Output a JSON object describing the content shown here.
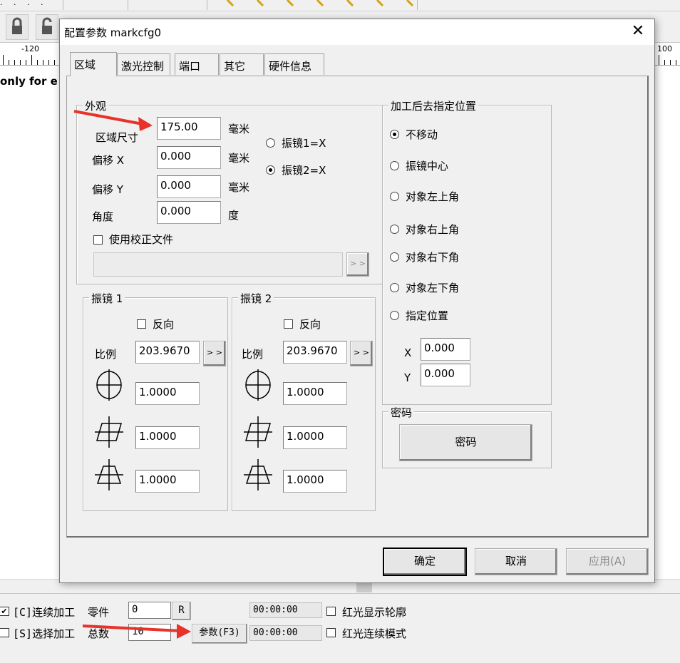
{
  "app": {
    "canvas_text": "only for e",
    "ruler": {
      "left_label": "-120",
      "right_label": "100"
    },
    "bottom": {
      "continuous_label": "[C]连续加工",
      "continuous_checked": true,
      "select_label": "[S]选择加工",
      "select_checked": false,
      "part_label": "零件",
      "part_value": "0",
      "total_label": "总数",
      "total_value": "10",
      "r_button": "R",
      "params_button": "参数(F3)",
      "time1": "00:00:00",
      "time2": "00:00:00",
      "redlight_outline_label": "红光显示轮廓",
      "redlight_continuous_label": "红光连续模式"
    }
  },
  "dialog": {
    "title": "配置参数 markcfg0",
    "close_glyph": "✕",
    "tabs": [
      "区域",
      "激光控制",
      "端口",
      "其它",
      "硬件信息"
    ],
    "active_tab": 0,
    "appearance": {
      "group_label": "外观",
      "area_size_label": "区域尺寸",
      "area_size_value": "175.00",
      "area_size_unit": "毫米",
      "offset_x_label": "偏移 X",
      "offset_x_value": "0.000",
      "offset_x_unit": "毫米",
      "offset_y_label": "偏移 Y",
      "offset_y_value": "0.000",
      "offset_y_unit": "毫米",
      "angle_label": "角度",
      "angle_value": "0.000",
      "angle_unit": "度",
      "galvo1_x_label": "振镜1=X",
      "galvo2_x_label": "振镜2=X",
      "galvo_selected": 2,
      "use_correction_label": "使用校正文件",
      "correction_file_value": "",
      "browse_label": "> >"
    },
    "galvo1": {
      "group_label": "振镜 1",
      "reverse_label": "反向",
      "scale_label": "比例",
      "scale_value": "203.9670",
      "scale_btn": "> >",
      "v1": "1.0000",
      "v2": "1.0000",
      "v3": "1.0000"
    },
    "galvo2": {
      "group_label": "振镜 2",
      "reverse_label": "反向",
      "scale_label": "比例",
      "scale_value": "203.9670",
      "scale_btn": "> >",
      "v1": "1.0000",
      "v2": "1.0000",
      "v3": "1.0000"
    },
    "goto_after": {
      "group_label": "加工后去指定位置",
      "options": [
        "不移动",
        "振镜中心",
        "对象左上角",
        "对象右上角",
        "对象右下角",
        "对象左下角",
        "指定位置"
      ],
      "selected": 0,
      "x_label": "X",
      "x_value": "0.000",
      "y_label": "Y",
      "y_value": "0.000"
    },
    "password": {
      "group_label": "密码",
      "button_label": "密码"
    },
    "buttons": {
      "ok": "确定",
      "cancel": "取消",
      "apply": "应用(A)"
    }
  },
  "colors": {
    "arrow": "#e8332a",
    "dialog_bg": "#f0f0f0"
  }
}
